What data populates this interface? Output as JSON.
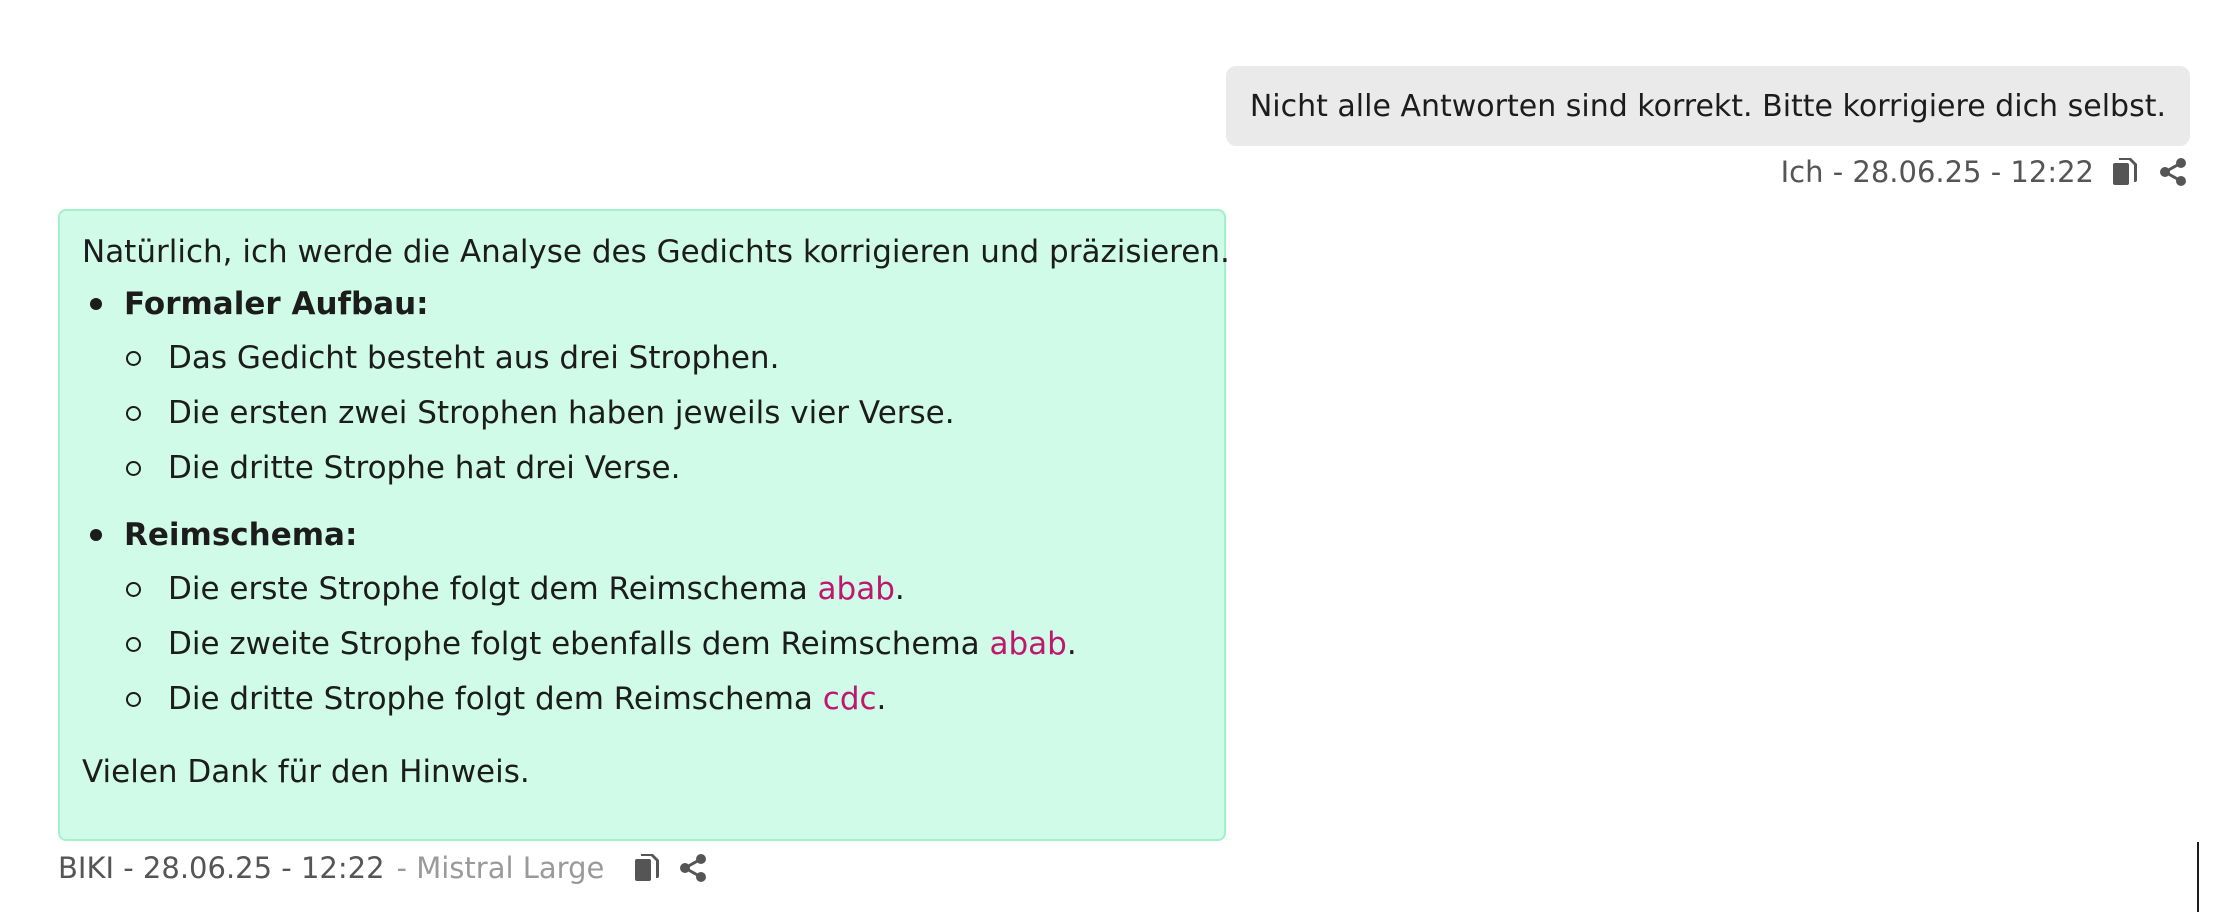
{
  "user_message": {
    "text": "Nicht alle Antworten sind korrekt. Bitte korrigiere dich selbst.",
    "meta": "Ich - 28.06.25 - 12:22",
    "copy_icon": "copy-icon",
    "share_icon": "share-icon"
  },
  "bot_message": {
    "intro": "Natürlich, ich werde die Analyse des Gedichts korrigieren und präzisieren.",
    "sections": [
      {
        "heading": "Formaler Aufbau:",
        "items": [
          {
            "pre": "Das Gedicht besteht aus drei Strophen.",
            "code": "",
            "post": ""
          },
          {
            "pre": "Die ersten zwei Strophen haben jeweils vier Verse.",
            "code": "",
            "post": ""
          },
          {
            "pre": "Die dritte Strophe hat drei Verse.",
            "code": "",
            "post": ""
          }
        ]
      },
      {
        "heading": "Reimschema:",
        "items": [
          {
            "pre": "Die erste Strophe folgt dem Reimschema ",
            "code": "abab",
            "post": "."
          },
          {
            "pre": "Die zweite Strophe folgt ebenfalls dem Reimschema ",
            "code": "abab",
            "post": "."
          },
          {
            "pre": "Die dritte Strophe folgt dem Reimschema ",
            "code": "cdc",
            "post": "."
          }
        ]
      }
    ],
    "outro": "Vielen Dank für den Hinweis.",
    "meta": "BIKI - 28.06.25 - 12:22",
    "model": "- Mistral Large",
    "copy_icon": "copy-icon",
    "share_icon": "share-icon"
  },
  "colors": {
    "user_bubble": "#eaeaea",
    "bot_bubble": "#cffbe8",
    "bot_border": "#a3f0cd",
    "code_text": "#c0176e",
    "meta_text": "#555555",
    "model_text": "#9a9a9a"
  }
}
